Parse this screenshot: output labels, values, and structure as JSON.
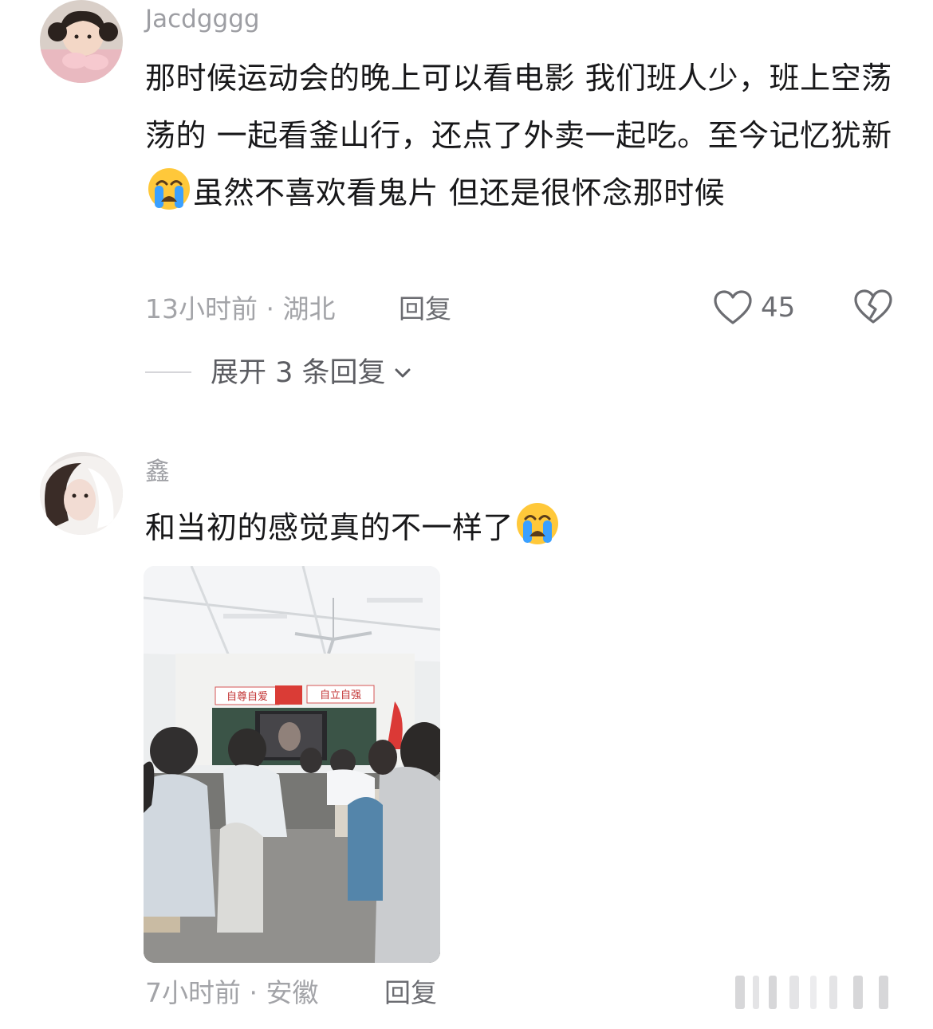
{
  "comments": [
    {
      "username": "Jacdgggg",
      "text_part1": "那时候运动会的晚上可以看电影 我们班人少，班上空荡荡的 一起看釜山行，还点了外卖一起吃。至今记忆犹新",
      "emoji": "loudly-crying-face",
      "text_part2": "虽然不喜欢看鬼片 但还是很怀念那时候",
      "time_location": "13小时前 · 湖北",
      "reply_label": "回复",
      "like_count": "45",
      "expand_label": "展开 3 条回复"
    },
    {
      "username": "鑫",
      "text_part1": "和当初的感觉真的不一样了",
      "emoji": "loudly-crying-face",
      "time_location": "7小时前 · 安徽",
      "reply_label": "回复",
      "photo": {
        "banner_left": "自尊自爱",
        "banner_right": "自立自强"
      }
    }
  ],
  "colors": {
    "text": "#18181a",
    "meta": "#a3a4a8",
    "username": "#9d9ea3",
    "emoji_face": "#ffc83a",
    "emoji_tear": "#3aa0ff"
  }
}
